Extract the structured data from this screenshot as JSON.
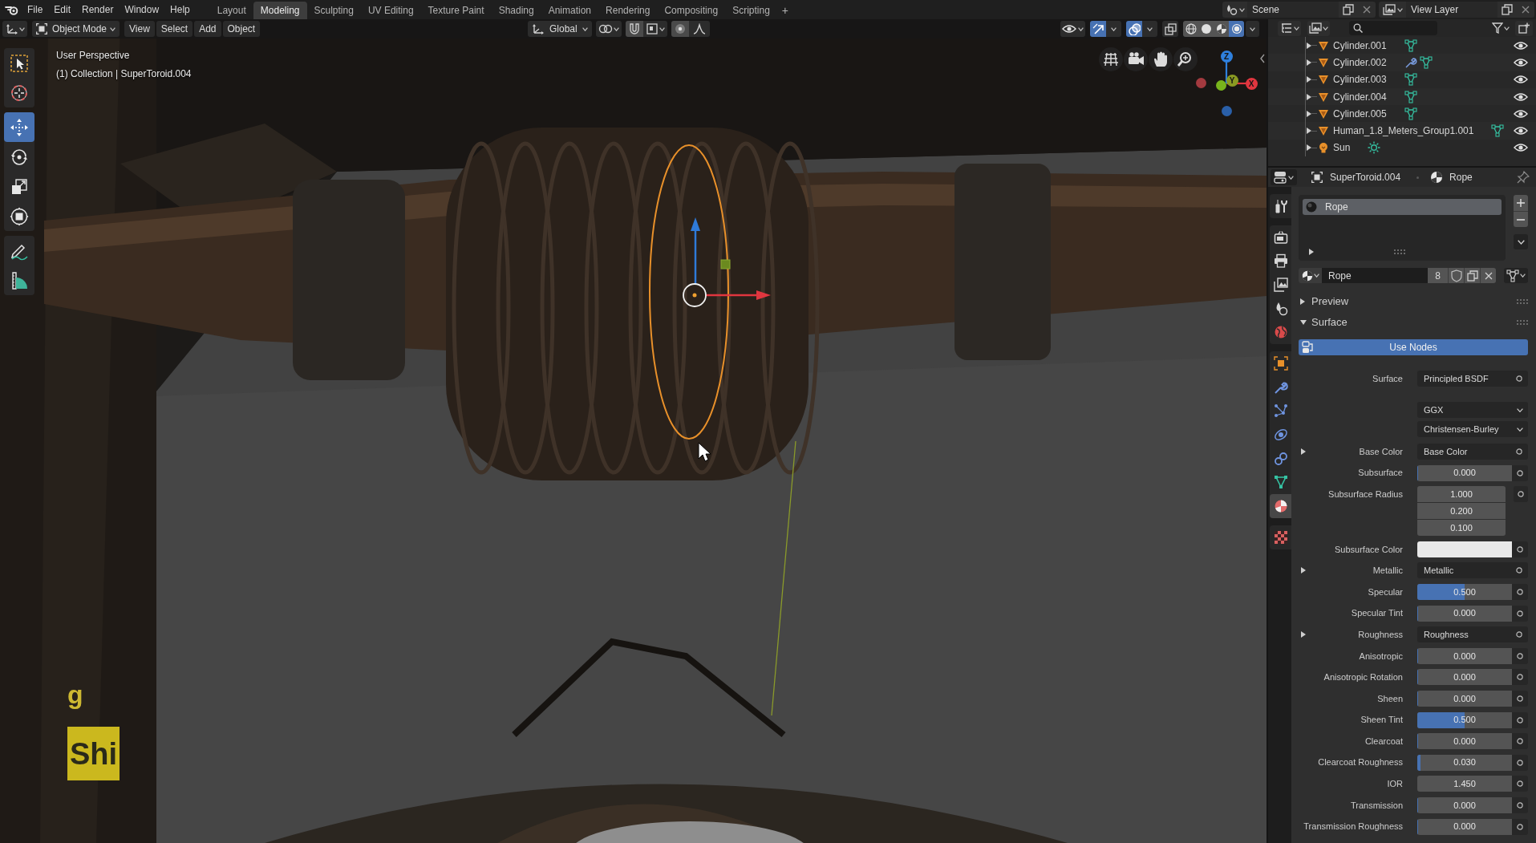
{
  "top_bar": {
    "menus": [
      "File",
      "Edit",
      "Render",
      "Window",
      "Help"
    ],
    "workspaces": [
      {
        "label": "Layout",
        "selected": false
      },
      {
        "label": "Modeling",
        "selected": true
      },
      {
        "label": "Sculpting",
        "selected": false
      },
      {
        "label": "UV Editing",
        "selected": false
      },
      {
        "label": "Texture Paint",
        "selected": false
      },
      {
        "label": "Shading",
        "selected": false
      },
      {
        "label": "Animation",
        "selected": false
      },
      {
        "label": "Rendering",
        "selected": false
      },
      {
        "label": "Compositing",
        "selected": false
      },
      {
        "label": "Scripting",
        "selected": false
      }
    ],
    "add_workspace": "+",
    "scene": "Scene",
    "view_layer": "View Layer"
  },
  "viewport_header": {
    "mode": "Object Mode",
    "menus": [
      "View",
      "Select",
      "Add",
      "Object"
    ],
    "orientation": "Global",
    "toggles": [
      {
        "kind": "gizmos",
        "on": true
      },
      {
        "kind": "overlays",
        "on": true
      },
      {
        "kind": "xray",
        "on": false
      }
    ],
    "shading": [
      {
        "kind": "wireframe",
        "selected": false
      },
      {
        "kind": "solid",
        "selected": false
      },
      {
        "kind": "material",
        "selected": false
      },
      {
        "kind": "rendered",
        "selected": true
      }
    ]
  },
  "viewport": {
    "view_name": "User Perspective",
    "object_info": "(1) Collection | SuperToroid.004",
    "tools": [
      {
        "kind": "select_box",
        "selected": false
      },
      {
        "kind": "cursor",
        "selected": false
      },
      {
        "kind": "move",
        "selected": true
      },
      {
        "kind": "rotate",
        "selected": false
      },
      {
        "kind": "scale",
        "selected": false
      },
      {
        "kind": "transform",
        "selected": false
      },
      {
        "kind": "annotate",
        "selected": false
      },
      {
        "kind": "measure",
        "selected": false
      }
    ],
    "axes": [
      {
        "label": "X",
        "color": "#e0363f"
      },
      {
        "label": "Y",
        "color": "#8a9a22"
      },
      {
        "label": "Z",
        "color": "#2f80dd"
      }
    ],
    "key_overlay": [
      {
        "kind": "plain",
        "text": "g"
      },
      {
        "kind": "boxed",
        "text": "Shi"
      }
    ]
  },
  "outliner": {
    "rows": [
      {
        "name": "Cylinder.001",
        "kind": "mesh",
        "modifier": false,
        "visible": true
      },
      {
        "name": "Cylinder.002",
        "kind": "mesh",
        "modifier": true,
        "visible": true
      },
      {
        "name": "Cylinder.003",
        "kind": "mesh",
        "modifier": false,
        "visible": true
      },
      {
        "name": "Cylinder.004",
        "kind": "mesh",
        "modifier": false,
        "visible": true
      },
      {
        "name": "Cylinder.005",
        "kind": "mesh",
        "modifier": false,
        "visible": true
      },
      {
        "name": "Human_1.8_Meters_Group1.001",
        "kind": "mesh",
        "modifier": false,
        "visible": true
      },
      {
        "name": "Sun",
        "kind": "light",
        "modifier": false,
        "visible": true
      }
    ]
  },
  "properties": {
    "object": "SuperToroid.004",
    "material": "Rope",
    "tabs": [
      {
        "kind": "tool",
        "selected": false
      },
      {
        "kind": "render",
        "selected": false
      },
      {
        "kind": "output",
        "selected": false
      },
      {
        "kind": "view_layer",
        "selected": false
      },
      {
        "kind": "scene",
        "selected": false
      },
      {
        "kind": "world",
        "selected": false
      },
      {
        "kind": "object",
        "selected": false
      },
      {
        "kind": "modifiers",
        "selected": false
      },
      {
        "kind": "particles",
        "selected": false
      },
      {
        "kind": "physics",
        "selected": false
      },
      {
        "kind": "constraints",
        "selected": false
      },
      {
        "kind": "data",
        "selected": false
      },
      {
        "kind": "material",
        "selected": true
      },
      {
        "kind": "texture",
        "selected": false
      }
    ],
    "slots": [
      {
        "name": "Rope",
        "selected": true
      }
    ],
    "material_name": "Rope",
    "users": "8",
    "panels": [
      {
        "title": "Preview",
        "expanded": false
      },
      {
        "title": "Surface",
        "expanded": true,
        "use_nodes": {
          "label": "Use Nodes",
          "on": true
        },
        "inputs": [
          {
            "kind": "shader",
            "label": "Surface",
            "value": "Principled BSDF"
          },
          {
            "kind": "dropdown",
            "value": "GGX"
          },
          {
            "kind": "dropdown",
            "value": "Christensen-Burley"
          },
          {
            "kind": "link",
            "label": "Base Color",
            "value": "Base Color"
          },
          {
            "kind": "slider",
            "label": "Subsurface",
            "value": "0.000",
            "level": 0
          },
          {
            "kind": "vector",
            "label": "Subsurface Radius",
            "values": [
              "1.000",
              "0.200",
              "0.100"
            ]
          },
          {
            "kind": "color",
            "label": "Subsurface Color",
            "color": "#e8e8e8"
          },
          {
            "kind": "link",
            "label": "Metallic",
            "value": "Metallic"
          },
          {
            "kind": "slider",
            "label": "Specular",
            "value": "0.500",
            "level": 0.5
          },
          {
            "kind": "slider",
            "label": "Specular Tint",
            "value": "0.000",
            "level": 0
          },
          {
            "kind": "link",
            "label": "Roughness",
            "value": "Roughness"
          },
          {
            "kind": "slider",
            "label": "Anisotropic",
            "value": "0.000",
            "level": 0
          },
          {
            "kind": "slider",
            "label": "Anisotropic Rotation",
            "value": "0.000",
            "level": 0
          },
          {
            "kind": "slider",
            "label": "Sheen",
            "value": "0.000",
            "level": 0
          },
          {
            "kind": "slider",
            "label": "Sheen Tint",
            "value": "0.500",
            "level": 0.5
          },
          {
            "kind": "slider",
            "label": "Clearcoat",
            "value": "0.000",
            "level": 0
          },
          {
            "kind": "slider",
            "label": "Clearcoat Roughness",
            "value": "0.030",
            "level": 0.03
          },
          {
            "kind": "number",
            "label": "IOR",
            "value": "1.450"
          },
          {
            "kind": "slider",
            "label": "Transmission",
            "value": "0.000",
            "level": 0
          },
          {
            "kind": "slider",
            "label": "Transmission Roughness",
            "value": "0.000",
            "level": 0
          }
        ]
      }
    ]
  }
}
